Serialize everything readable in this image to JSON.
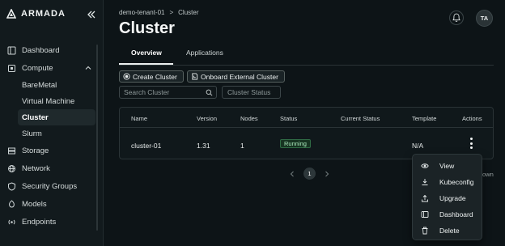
{
  "app": {
    "logo_text": "ARMADA"
  },
  "sidebar": {
    "items": [
      {
        "label": "Dashboard",
        "icon": "dashboard-icon"
      },
      {
        "label": "Compute",
        "icon": "compute-icon"
      },
      {
        "label": "BareMetal"
      },
      {
        "label": "Virtual Machine"
      },
      {
        "label": "Cluster"
      },
      {
        "label": "Slurm"
      },
      {
        "label": "Storage",
        "icon": "storage-icon"
      },
      {
        "label": "Network",
        "icon": "network-icon"
      },
      {
        "label": "Security Groups",
        "icon": "shield-icon"
      },
      {
        "label": "Models",
        "icon": "models-icon"
      },
      {
        "label": "Endpoints",
        "icon": "endpoints-icon"
      }
    ]
  },
  "header": {
    "breadcrumb": {
      "tenant": "demo-tenant-01",
      "separator": ">",
      "current": "Cluster"
    },
    "title": "Cluster",
    "avatar_initials": "TA"
  },
  "tabs": [
    {
      "label": "Overview"
    },
    {
      "label": "Applications"
    }
  ],
  "toolbar": {
    "create_label": "Create Cluster",
    "onboard_label": "Onboard External Cluster"
  },
  "filters": {
    "search_placeholder": "Search Cluster",
    "status_placeholder": "Cluster Status"
  },
  "table": {
    "columns": [
      "Name",
      "Version",
      "Nodes",
      "Status",
      "Current Status",
      "Template",
      "Actions"
    ],
    "rows": [
      {
        "name": "cluster-01",
        "version": "1.31",
        "nodes": "1",
        "status": "Running",
        "current_status": "",
        "template": "N/A"
      }
    ]
  },
  "pagination": {
    "current_page": "1",
    "trailing_text": "own"
  },
  "context_menu": {
    "items": [
      {
        "label": "View",
        "icon": "eye-icon"
      },
      {
        "label": "Kubeconfig",
        "icon": "download-icon"
      },
      {
        "label": "Upgrade",
        "icon": "upload-icon"
      },
      {
        "label": "Dashboard",
        "icon": "dashboard-icon"
      },
      {
        "label": "Delete",
        "icon": "trash-icon"
      }
    ]
  },
  "colors": {
    "background": "#0d1417",
    "sidebar": "#121a1d",
    "running_badge": "#173422",
    "running_text": "#a9e6bb"
  }
}
